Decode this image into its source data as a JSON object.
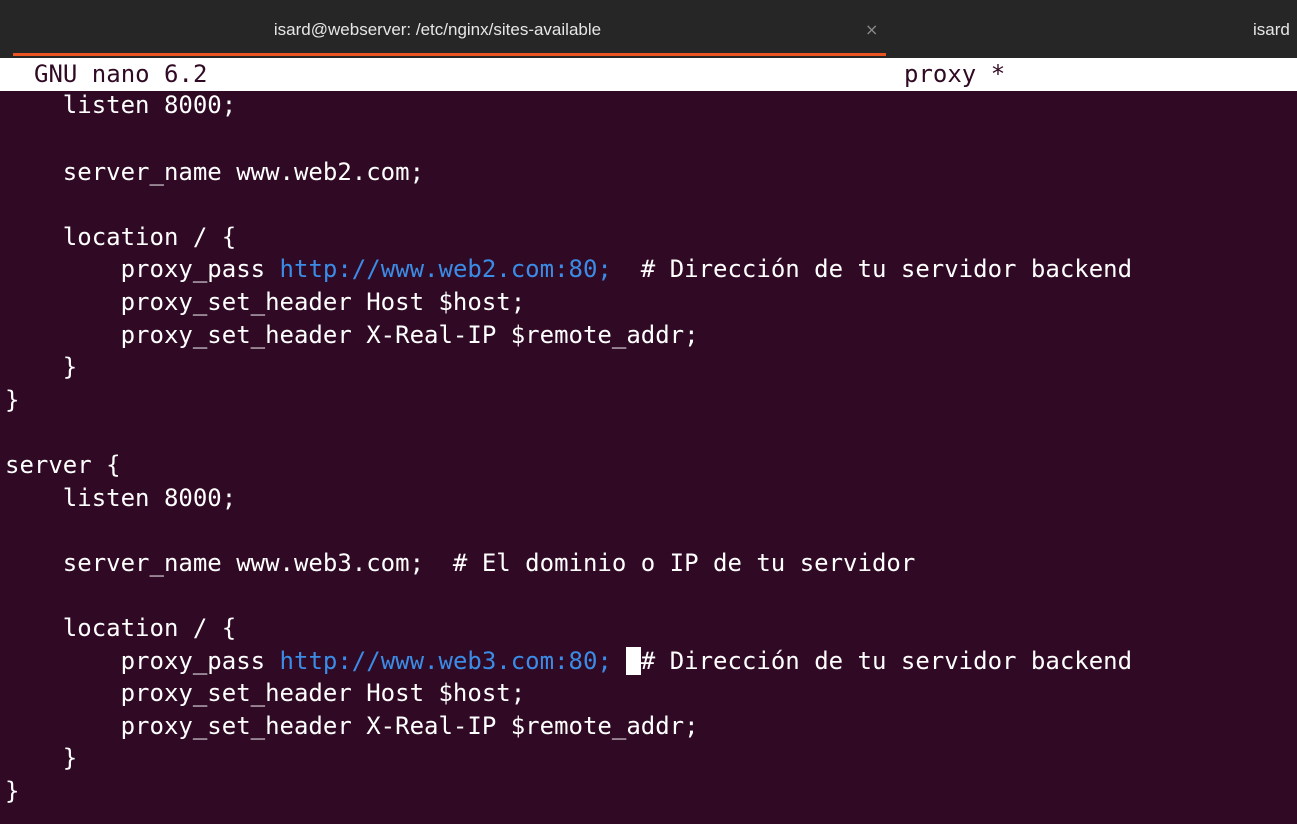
{
  "window": {
    "tab_title": "isard@webserver: /etc/nginx/sites-available",
    "tab_close": "×",
    "second_tab_title": "isard"
  },
  "nano": {
    "app_name": "GNU nano 6.2",
    "file_name": "proxy *"
  },
  "colors": {
    "background": "#300a24",
    "text": "#ffffff",
    "url": "#3a8ce6",
    "tab_accent": "#e95420"
  },
  "editor": {
    "lines": [
      [
        "    listen 8000;"
      ],
      [
        ""
      ],
      [
        "    server_name www.web2.com;"
      ],
      [
        ""
      ],
      [
        "    location / {"
      ],
      [
        "        proxy_pass ",
        "http://www.web2.com:80;",
        "  # Dirección de tu servidor backend"
      ],
      [
        "        proxy_set_header Host $host;"
      ],
      [
        "        proxy_set_header X-Real-IP $remote_addr;"
      ],
      [
        "    }"
      ],
      [
        "}"
      ],
      [
        ""
      ],
      [
        "server {"
      ],
      [
        "    listen 8000;"
      ],
      [
        ""
      ],
      [
        "    server_name www.web3.com;  # El dominio o IP de tu servidor"
      ],
      [
        ""
      ],
      [
        "    location / {"
      ],
      [
        "        proxy_pass ",
        "http://www.web3.com:80;",
        " ",
        " ",
        "# Dirección de tu servidor backend"
      ],
      [
        "        proxy_set_header Host $host;"
      ],
      [
        "        proxy_set_header X-Real-IP $remote_addr;"
      ],
      [
        "    }"
      ],
      [
        "}"
      ]
    ]
  }
}
